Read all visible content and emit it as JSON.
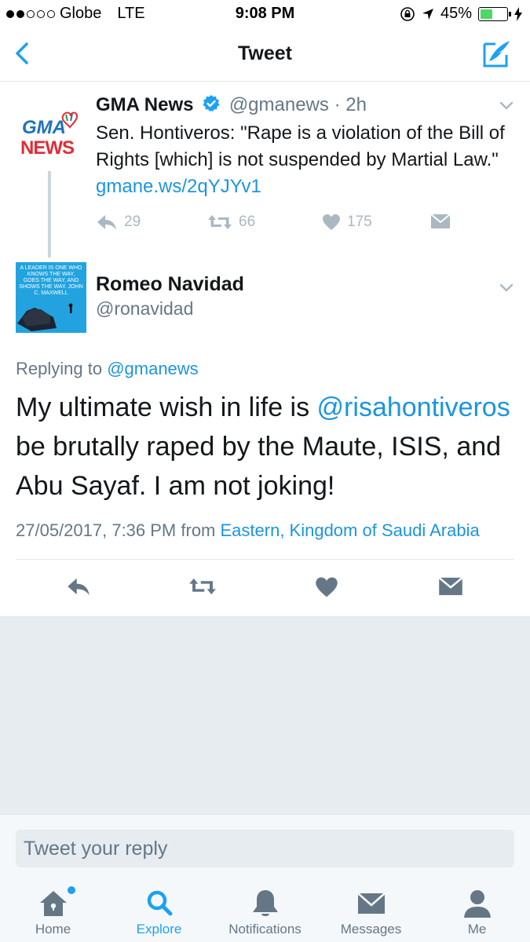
{
  "status_bar": {
    "carrier": "Globe",
    "network": "LTE",
    "time": "9:08 PM",
    "battery_percent": "45%",
    "battery_level": 0.45,
    "signal_bars": 2
  },
  "nav": {
    "title": "Tweet",
    "back_icon": "chevron-left-icon",
    "compose_icon": "compose-tweet-icon"
  },
  "quoted_tweet": {
    "avatar_text": "GMA NEWS",
    "name": "GMA News",
    "handle": "@gmanews",
    "time": "· 2h",
    "text": "Sen. Hontiveros: \"Rape is a violation of the Bill of Rights [which] is not suspended by Martial Law.\" ",
    "link": "gmane.ws/2qYJYv1",
    "replies": "29",
    "retweets": "66",
    "likes": "175"
  },
  "tweet": {
    "author_name": "Romeo Navidad",
    "author_handle": "@ronavidad",
    "avatar_text": "A LEADER IS ONE WHO KNOWS THE WAY, GOES THE WAY, AND SHOWS THE WAY. JOHN C. MAXWELL",
    "replying_prefix": "Replying to ",
    "replying_to": "@gmanews",
    "text_before": "My ultimate wish in life is ",
    "mention": "@risahontiveros",
    "text_after": " be brutally raped by the Maute, ISIS, and Abu Sayaf. I am not joking!",
    "timestamp": "27/05/2017, 7:36 PM from ",
    "location": "Eastern, Kingdom of Saudi Arabia"
  },
  "reply_box": {
    "placeholder": "Tweet your reply"
  },
  "tabs": [
    {
      "label": "Home",
      "icon": "home-icon"
    },
    {
      "label": "Explore",
      "icon": "search-icon"
    },
    {
      "label": "Notifications",
      "icon": "bell-icon"
    },
    {
      "label": "Messages",
      "icon": "envelope-icon"
    },
    {
      "label": "Me",
      "icon": "person-icon"
    }
  ],
  "colors": {
    "accent": "#1da1f2",
    "link": "#1b95e0",
    "text": "#14171a",
    "secondary": "#657786",
    "divider": "#e1e8ed",
    "battery": "#4cd964"
  }
}
